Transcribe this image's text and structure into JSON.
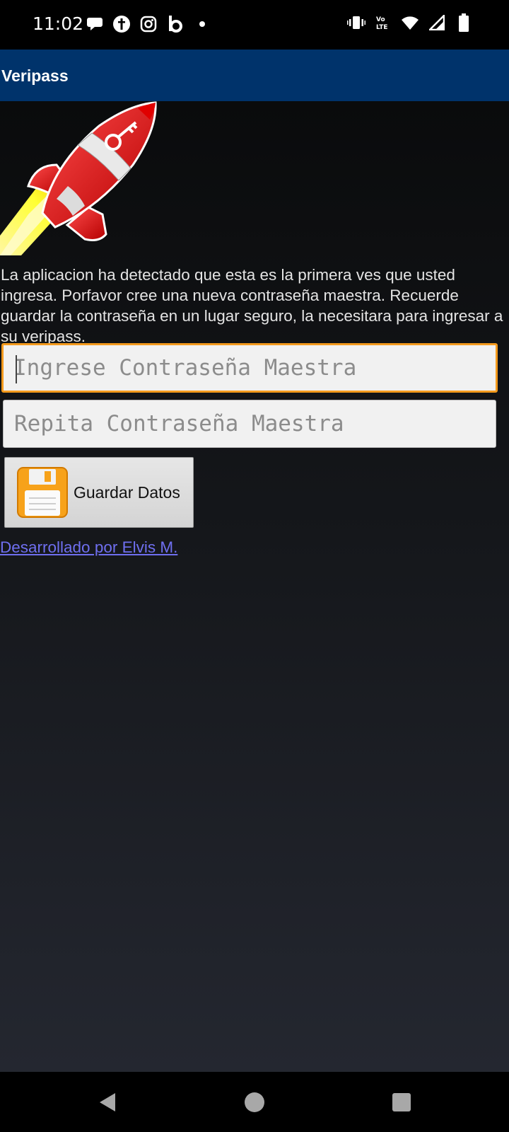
{
  "status_bar": {
    "time": "11:02",
    "left_icons": [
      "chat-bubble-icon",
      "messenger-icon",
      "instagram-icon",
      "beat-icon",
      "dot-icon"
    ],
    "right_icons": [
      "vibrate-icon",
      "volte-icon",
      "wifi-icon",
      "signal-icon",
      "battery-icon"
    ]
  },
  "app_bar": {
    "title": "Veripass"
  },
  "main": {
    "logo_icon": "rocket-key-icon",
    "message": "La aplicacion ha detectado que esta es la primera ves que usted ingresa. Porfavor cree una nueva contraseña maestra. Recuerde guardar la contraseña en un lugar seguro, la necesitara para ingresar a su veripass.",
    "master_password": {
      "value": "",
      "placeholder": "Ingrese Contraseña Maestra"
    },
    "repeat_password": {
      "value": "",
      "placeholder": "Repita Contraseña Maestra"
    },
    "save_button": {
      "label": "Guardar Datos",
      "icon": "floppy-disk-icon"
    },
    "credit_link": "Desarrollado por Elvis M."
  },
  "colors": {
    "app_bar": "#00336b",
    "focus_border": "#f39a1d",
    "link": "#6f6ff0"
  },
  "nav_bar": {
    "icons": [
      "back-icon",
      "home-icon",
      "recents-icon"
    ]
  }
}
